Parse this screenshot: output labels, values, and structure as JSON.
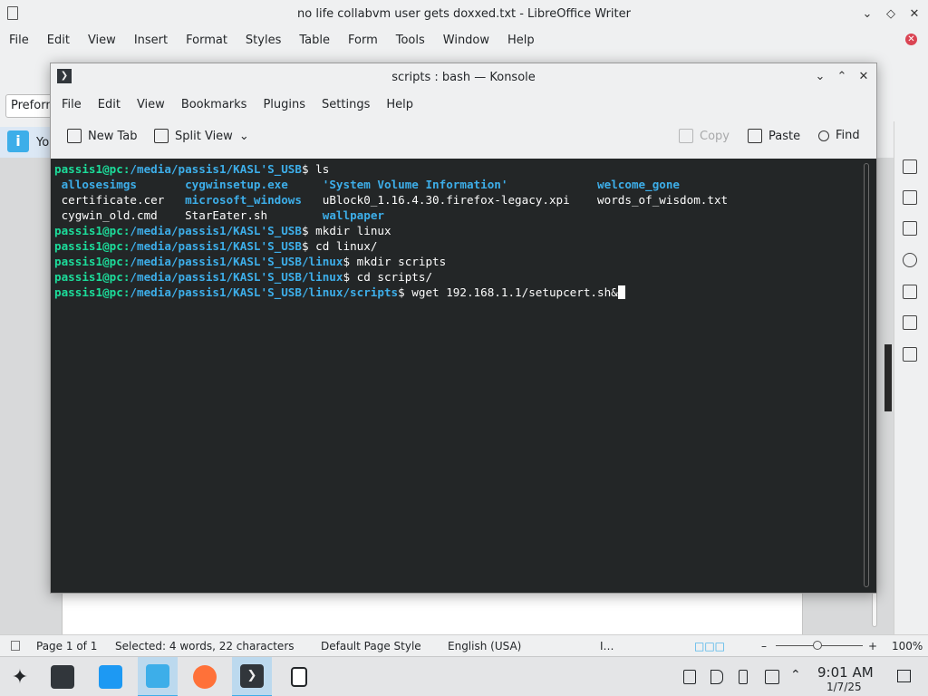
{
  "libreoffice": {
    "window_title": "no life collabvm user gets doxxed.txt - LibreOffice Writer",
    "menu": [
      "File",
      "Edit",
      "View",
      "Insert",
      "Format",
      "Styles",
      "Table",
      "Form",
      "Tools",
      "Window",
      "Help"
    ],
    "paragraph_style": "Preformatted Text",
    "infobar_text": "Yo",
    "status": {
      "page": "Page 1 of 1",
      "selection": "Selected: 4 words, 22 characters",
      "page_style": "Default Page Style",
      "language": "English (USA)",
      "zoom": "100%"
    }
  },
  "konsole": {
    "window_title": "scripts : bash — Konsole",
    "menu": [
      "File",
      "Edit",
      "View",
      "Bookmarks",
      "Plugins",
      "Settings",
      "Help"
    ],
    "toolbar": {
      "new_tab": "New Tab",
      "split_view": "Split View",
      "copy": "Copy",
      "paste": "Paste",
      "find": "Find"
    },
    "prompt_user": "passis1@pc",
    "lines": [
      {
        "path": "/media/passis1/KASL'S_USB",
        "cmd": "ls"
      },
      {
        "listing": [
          {
            "text": "allosesimgs",
            "kind": "dir"
          },
          {
            "text": "cygwinsetup.exe",
            "kind": "dir"
          },
          {
            "text": "'System Volume Information'",
            "kind": "dir"
          },
          {
            "text": "welcome_gone",
            "kind": "dir"
          }
        ]
      },
      {
        "listing": [
          {
            "text": "certificate.cer",
            "kind": "file"
          },
          {
            "text": "microsoft_windows",
            "kind": "dir"
          },
          {
            "text": "uBlock0_1.16.4.30.firefox-legacy.xpi",
            "kind": "file"
          },
          {
            "text": "words_of_wisdom.txt",
            "kind": "file"
          }
        ]
      },
      {
        "listing": [
          {
            "text": "cygwin_old.cmd",
            "kind": "file"
          },
          {
            "text": "StarEater.sh",
            "kind": "file"
          },
          {
            "text": "wallpaper",
            "kind": "dir"
          }
        ]
      },
      {
        "path": "/media/passis1/KASL'S_USB",
        "cmd": "mkdir linux"
      },
      {
        "path": "/media/passis1/KASL'S_USB",
        "cmd": "cd linux/"
      },
      {
        "path": "/media/passis1/KASL'S_USB/linux",
        "cmd": "mkdir scripts"
      },
      {
        "path": "/media/passis1/KASL'S_USB/linux",
        "cmd": "cd scripts/"
      },
      {
        "path": "/media/passis1/KASL'S_USB/linux/scripts",
        "cmd": "wget 192.168.1.1/setupcert.sh&",
        "cursor": true
      }
    ]
  },
  "taskbar": {
    "apps": [
      "application-launcher-icon",
      "system-settings-icon",
      "discover-store-icon",
      "dolphin-files-icon",
      "firefox-icon",
      "konsole-icon",
      "libreoffice-writer-icon"
    ],
    "clock_time": "9:01 AM",
    "clock_date": "1/7/25"
  },
  "colors": {
    "terminal_bg": "#232627",
    "prompt_user": "#1cdc9a",
    "prompt_path": "#3daee9",
    "accent": "#3daee9"
  }
}
